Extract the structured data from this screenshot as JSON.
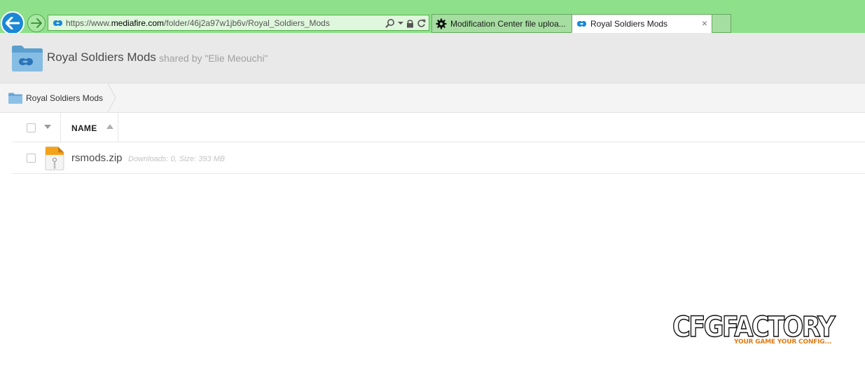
{
  "browser": {
    "address": {
      "prefix": "https://www.",
      "domain": "mediafire.com",
      "path": "/folder/46j2a97w1jb6v/Royal_Soldiers_Mods"
    },
    "tabs": [
      {
        "label": "Modification Center file uploa...",
        "active": false,
        "icon": "gear-logo-icon"
      },
      {
        "label": "Royal Soldiers Mods",
        "active": true,
        "icon": "mediafire-icon",
        "close": "×"
      }
    ]
  },
  "folder": {
    "title": "Royal Soldiers Mods",
    "shared_by": "shared by \"Elie Meouchi\""
  },
  "breadcrumb": {
    "items": [
      "Royal Soldiers Mods"
    ]
  },
  "list": {
    "header": {
      "name": "NAME"
    },
    "files": [
      {
        "name": "rsmods.zip",
        "downloads": "Downloads: 0,",
        "size": "Size: 393 MB"
      }
    ]
  },
  "watermark": {
    "main": "CFGFACTORY",
    "tagline": "YOUR GAME YOUR CONFIG..."
  },
  "colors": {
    "chrome_green": "#8fe08a",
    "back_blue": "#1a88d6",
    "mediafire_blue": "#1a88d6",
    "zip_orange": "#f5a21b"
  }
}
